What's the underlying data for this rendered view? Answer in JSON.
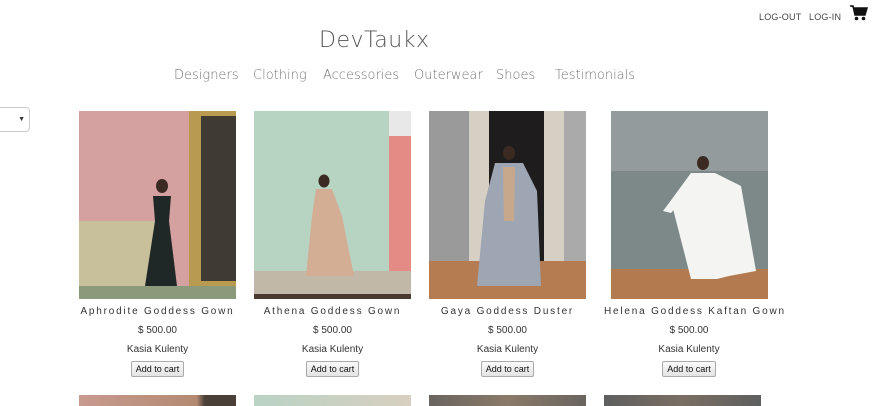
{
  "header": {
    "brand": "DevTaukx",
    "logout_label": "LOG-OUT",
    "login_label": "LOG-IN"
  },
  "nav": {
    "items": [
      "Designers",
      "Clothing",
      "Accessories",
      "Outerwear",
      "Shoes",
      "Testimonials"
    ]
  },
  "products": [
    {
      "name": "Aphrodite Goddess Gown",
      "price": "$ 500.00",
      "designer": "Kasia Kulenty",
      "button": "Add to cart"
    },
    {
      "name": "Athena Goddess Gown",
      "price": "$ 500.00",
      "designer": "Kasia Kulenty",
      "button": "Add to cart"
    },
    {
      "name": "Gaya Goddess Duster",
      "price": "$ 500.00",
      "designer": "Kasia Kulenty",
      "button": "Add to cart"
    },
    {
      "name": "Helena Goddess Kaftan Gown",
      "price": "$ 500.00",
      "designer": "Kasia Kulenty",
      "button": "Add to cart"
    }
  ],
  "icons": {
    "cart": "shopping-cart-icon",
    "caret": "caret-down-icon"
  }
}
